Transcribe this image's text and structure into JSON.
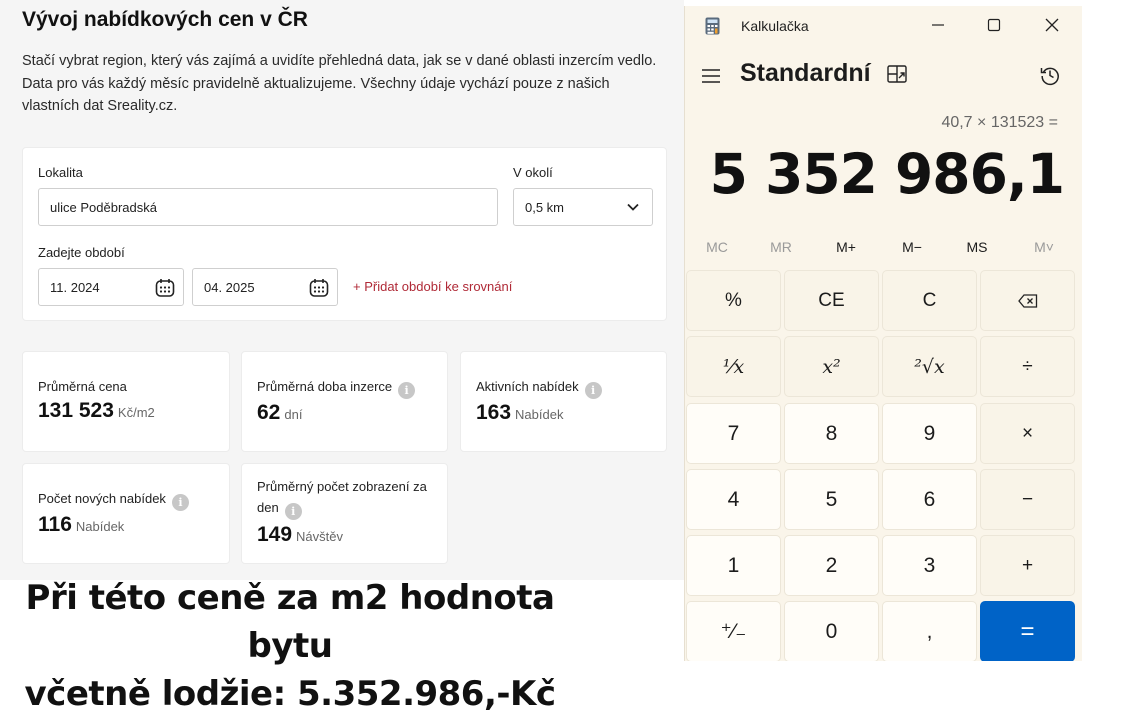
{
  "page": {
    "title": "Vývoj nabídkových cen v ČR",
    "description": "Stačí vybrat region, který vás zajímá a uvidíte přehledná data, jak se v dané oblasti inzercím vedlo. Data pro vás každý měsíc pravidelně aktualizujeme. Všechny údaje vychází pouze z našich vlastních dat Sreality.cz.",
    "filter": {
      "locality_label": "Lokalita",
      "locality_value": "ulice Poděbradská",
      "radius_label": "V okolí",
      "radius_value": "0,5 km",
      "period_label": "Zadejte období",
      "period_from": "11. 2024",
      "period_to": "04. 2025",
      "add_period_link": "+ Přidat období ke srovnání"
    },
    "stats": [
      {
        "label": "Průměrná cena",
        "value": "131 523",
        "unit": "Kč/m2"
      },
      {
        "label": "Průměrná doba inzerce",
        "value": "62",
        "unit": "dní"
      },
      {
        "label": "Aktivních nabídek",
        "value": "163",
        "unit": "Nabídek"
      },
      {
        "label": "Počet nových nabídek",
        "value": "116",
        "unit": "Nabídek"
      },
      {
        "label": "Průměrný počet zobrazení za den",
        "value": "149",
        "unit": "Návštěv"
      }
    ],
    "info_glyph": "i"
  },
  "caption": {
    "line1": "Při této ceně za m2 hodnota bytu",
    "line2": "včetně lodžie: 5.352.986,-Kč"
  },
  "calculator": {
    "app_name": "Kalkulačka",
    "mode": "Standardní",
    "expression": "40,7 × 131523 =",
    "display": "5 352 986,1",
    "memory": [
      "MC",
      "MR",
      "M+",
      "M−",
      "MS",
      "M˅"
    ],
    "keys": {
      "percent": "%",
      "ce": "CE",
      "c": "C",
      "backspace": "⌫",
      "reciprocal": "¹⁄x",
      "square": "x²",
      "sqrt": "²√x",
      "divide": "÷",
      "seven": "7",
      "eight": "8",
      "nine": "9",
      "multiply": "×",
      "four": "4",
      "five": "5",
      "six": "6",
      "minus": "−",
      "one": "1",
      "two": "2",
      "three": "3",
      "plus": "+",
      "negate": "⁺⁄₋",
      "zero": "0",
      "decimal": ",",
      "equals": "="
    },
    "colors": {
      "background": "#faf5ea",
      "accent": "#0063c7"
    },
    "icons": [
      "calculator-app-icon",
      "minimize-icon",
      "maximize-icon",
      "close-icon",
      "hamburger-menu-icon",
      "keep-on-top-icon",
      "history-icon"
    ]
  }
}
